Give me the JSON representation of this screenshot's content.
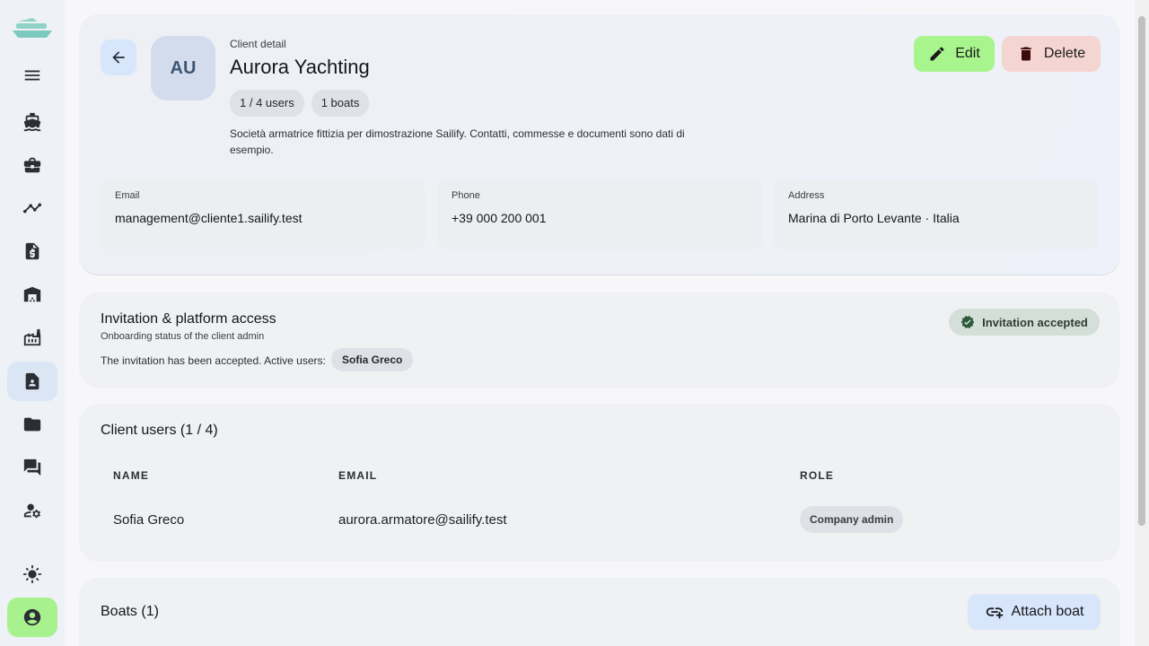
{
  "app": {
    "logo_icon": "ship-logo-icon",
    "accent": "#a9f58d"
  },
  "sidebar": {
    "items": [
      {
        "name": "menu",
        "icon": "menu-icon"
      },
      {
        "name": "boats",
        "icon": "boat-icon"
      },
      {
        "name": "jobs",
        "icon": "briefcase-icon"
      },
      {
        "name": "analytics",
        "icon": "trending-icon"
      },
      {
        "name": "invoices",
        "icon": "invoice-icon"
      },
      {
        "name": "shipyards",
        "icon": "warehouse-icon"
      },
      {
        "name": "suppliers",
        "icon": "factory-icon"
      },
      {
        "name": "clients",
        "icon": "contact-card-icon",
        "active": true
      },
      {
        "name": "documents",
        "icon": "folder-icon"
      },
      {
        "name": "messages",
        "icon": "chat-icon"
      },
      {
        "name": "user-settings",
        "icon": "user-gear-icon"
      },
      {
        "name": "theme",
        "icon": "sun-icon"
      },
      {
        "name": "account",
        "icon": "account-circle-icon"
      }
    ]
  },
  "header": {
    "eyebrow": "Client detail",
    "title": "Aurora Yachting",
    "avatar_initials": "AU",
    "chips": [
      "1 / 4 users",
      "1 boats"
    ],
    "description": "Società armatrice fittizia per dimostrazione Sailify. Contatti, commesse e documenti sono dati di esempio.",
    "edit_label": "Edit",
    "delete_label": "Delete"
  },
  "contact": {
    "email_label": "Email",
    "email_value": "management@cliente1.sailify.test",
    "phone_label": "Phone",
    "phone_value": "+39 000 200 001",
    "address_label": "Address",
    "address_value": "Marina di Porto Levante · Italia"
  },
  "invitation": {
    "title": "Invitation & platform access",
    "subtitle": "Onboarding status of the client admin",
    "text": "The invitation has been accepted. Active users:",
    "active_user": "Sofia Greco",
    "status": "Invitation accepted"
  },
  "users": {
    "title": "Client users (1 / 4)",
    "columns": [
      "NAME",
      "EMAIL",
      "ROLE"
    ],
    "rows": [
      {
        "name": "Sofia Greco",
        "email": "aurora.armatore@sailify.test",
        "role": "Company admin"
      }
    ]
  },
  "boats": {
    "title": "Boats (1)",
    "attach_label": "Attach boat"
  }
}
